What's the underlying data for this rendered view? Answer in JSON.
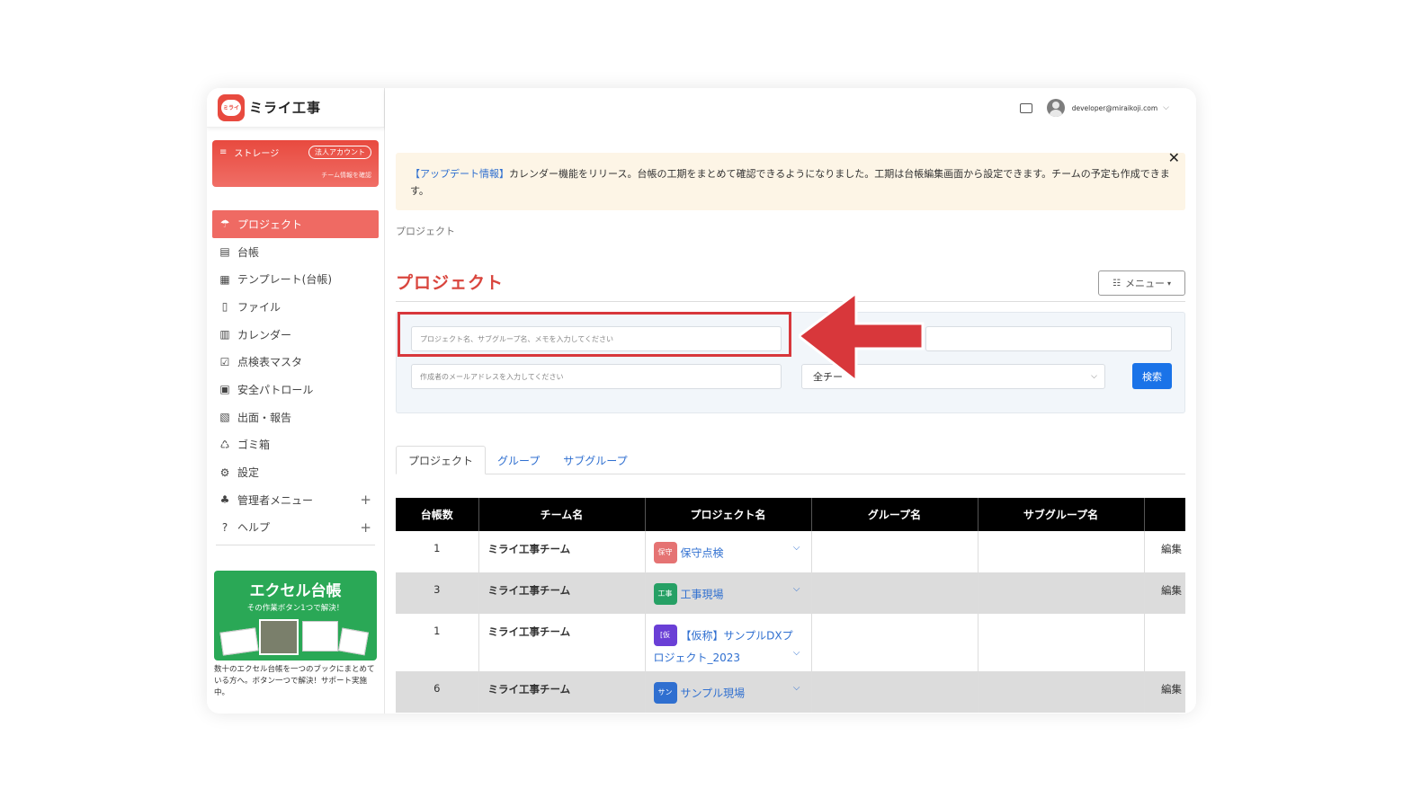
{
  "app": {
    "logo_mark": "ミライ",
    "name": "ミライ工事"
  },
  "storage": {
    "label": "ストレージ",
    "badge": "法人アカウント",
    "sub": "チーム情報を確認"
  },
  "nav": [
    {
      "label": "プロジェクト",
      "icon": "project-icon",
      "active": true
    },
    {
      "label": "台帳",
      "icon": "ledger-icon"
    },
    {
      "label": "テンプレート(台帳)",
      "icon": "template-icon"
    },
    {
      "label": "ファイル",
      "icon": "file-icon"
    },
    {
      "label": "カレンダー",
      "icon": "calendar-icon"
    },
    {
      "label": "点検表マスタ",
      "icon": "checklist-icon"
    },
    {
      "label": "安全パトロール",
      "icon": "patrol-icon"
    },
    {
      "label": "出面・報告",
      "icon": "report-icon"
    },
    {
      "label": "ゴミ箱",
      "icon": "trash-icon"
    },
    {
      "label": "設定",
      "icon": "gear-icon"
    },
    {
      "label": "管理者メニュー",
      "icon": "admin-icon",
      "expandable": true
    },
    {
      "label": "ヘルプ",
      "icon": "help-icon",
      "expandable": true
    }
  ],
  "promo": {
    "title": "エクセル台帳",
    "subtitle": "その作業ボタン1つで解決！",
    "text": "数十のエクセル台帳を一つのブックにまとめている方へ。ボタン一つで解決！サポート実施中。"
  },
  "topbar": {
    "email": "developer@miraikoji.com"
  },
  "notice": {
    "highlight": "【アップデート情報】",
    "text": "カレンダー機能をリリース。台帳の工期をまとめて確認できるようになりました。工期は台帳編集画面から設定できます。チームの予定も作成できます。"
  },
  "breadcrumb": "プロジェクト",
  "page_title": "プロジェクト",
  "menu_button": "メニュー",
  "search": {
    "keyword_placeholder": "プロジェクト名、サブグループ名、メモを入力してください",
    "email_placeholder": "作成者のメールアドレスを入力してください",
    "team_select": "全チー",
    "button": "検索"
  },
  "tabs": [
    "プロジェクト",
    "グループ",
    "サブグループ"
  ],
  "table": {
    "headers": [
      "台帳数",
      "チーム名",
      "プロジェクト名",
      "グループ名",
      "サブグループ名",
      ""
    ],
    "rows": [
      {
        "count": "1",
        "team": "ミライ工事チーム",
        "tag": "保守",
        "tag_color": "#e57373",
        "project": "保守点検",
        "project2": "",
        "edit": "編集",
        "shade": "white"
      },
      {
        "count": "3",
        "team": "ミライ工事チーム",
        "tag": "工事",
        "tag_color": "#26a065",
        "project": "工事現場",
        "project2": "",
        "edit": "編集",
        "shade": "gray"
      },
      {
        "count": "1",
        "team": "ミライ工事チーム",
        "tag": "[仮",
        "tag_color": "#6a3fd6",
        "project": "【仮称】サンプルDXプ",
        "project2": "ロジェクト_2023",
        "edit": "",
        "shade": "white"
      },
      {
        "count": "6",
        "team": "ミライ工事チーム",
        "tag": "サン",
        "tag_color": "#2f6fd0",
        "project": "サンプル現場",
        "project2": "",
        "edit": "編集",
        "shade": "gray"
      }
    ]
  },
  "colors": {
    "brand": "#e84a3f",
    "link": "#2f6fd0",
    "arrow": "#d8373b",
    "primary_button": "#1a73e8"
  }
}
